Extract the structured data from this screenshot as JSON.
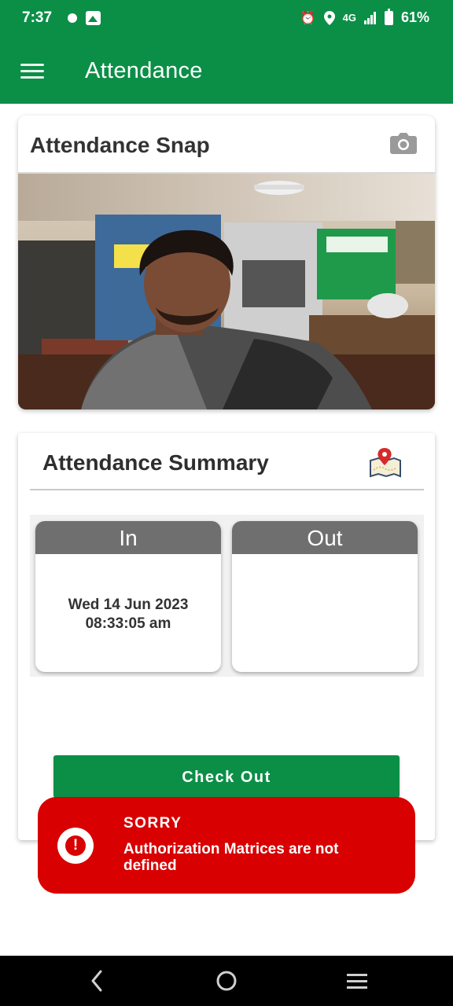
{
  "status_bar": {
    "time": "7:37",
    "network": "4G",
    "battery": "61%"
  },
  "app_bar": {
    "title": "Attendance"
  },
  "snap_card": {
    "title": "Attendance Snap",
    "icon": "camera-icon"
  },
  "summary_card": {
    "title": "Attendance Summary",
    "icon": "map-pin-icon",
    "in": {
      "label": "In",
      "date": "Wed 14 Jun 2023",
      "time": "08:33:05 am"
    },
    "out": {
      "label": "Out",
      "date": "",
      "time": ""
    },
    "checkout_label": "Check Out"
  },
  "toast": {
    "title": "SORRY",
    "message": "Authorization Matrices are not defined"
  },
  "colors": {
    "primary_green": "#0b8f47",
    "header_gray": "#6f6f6f",
    "error_red": "#d80000"
  }
}
